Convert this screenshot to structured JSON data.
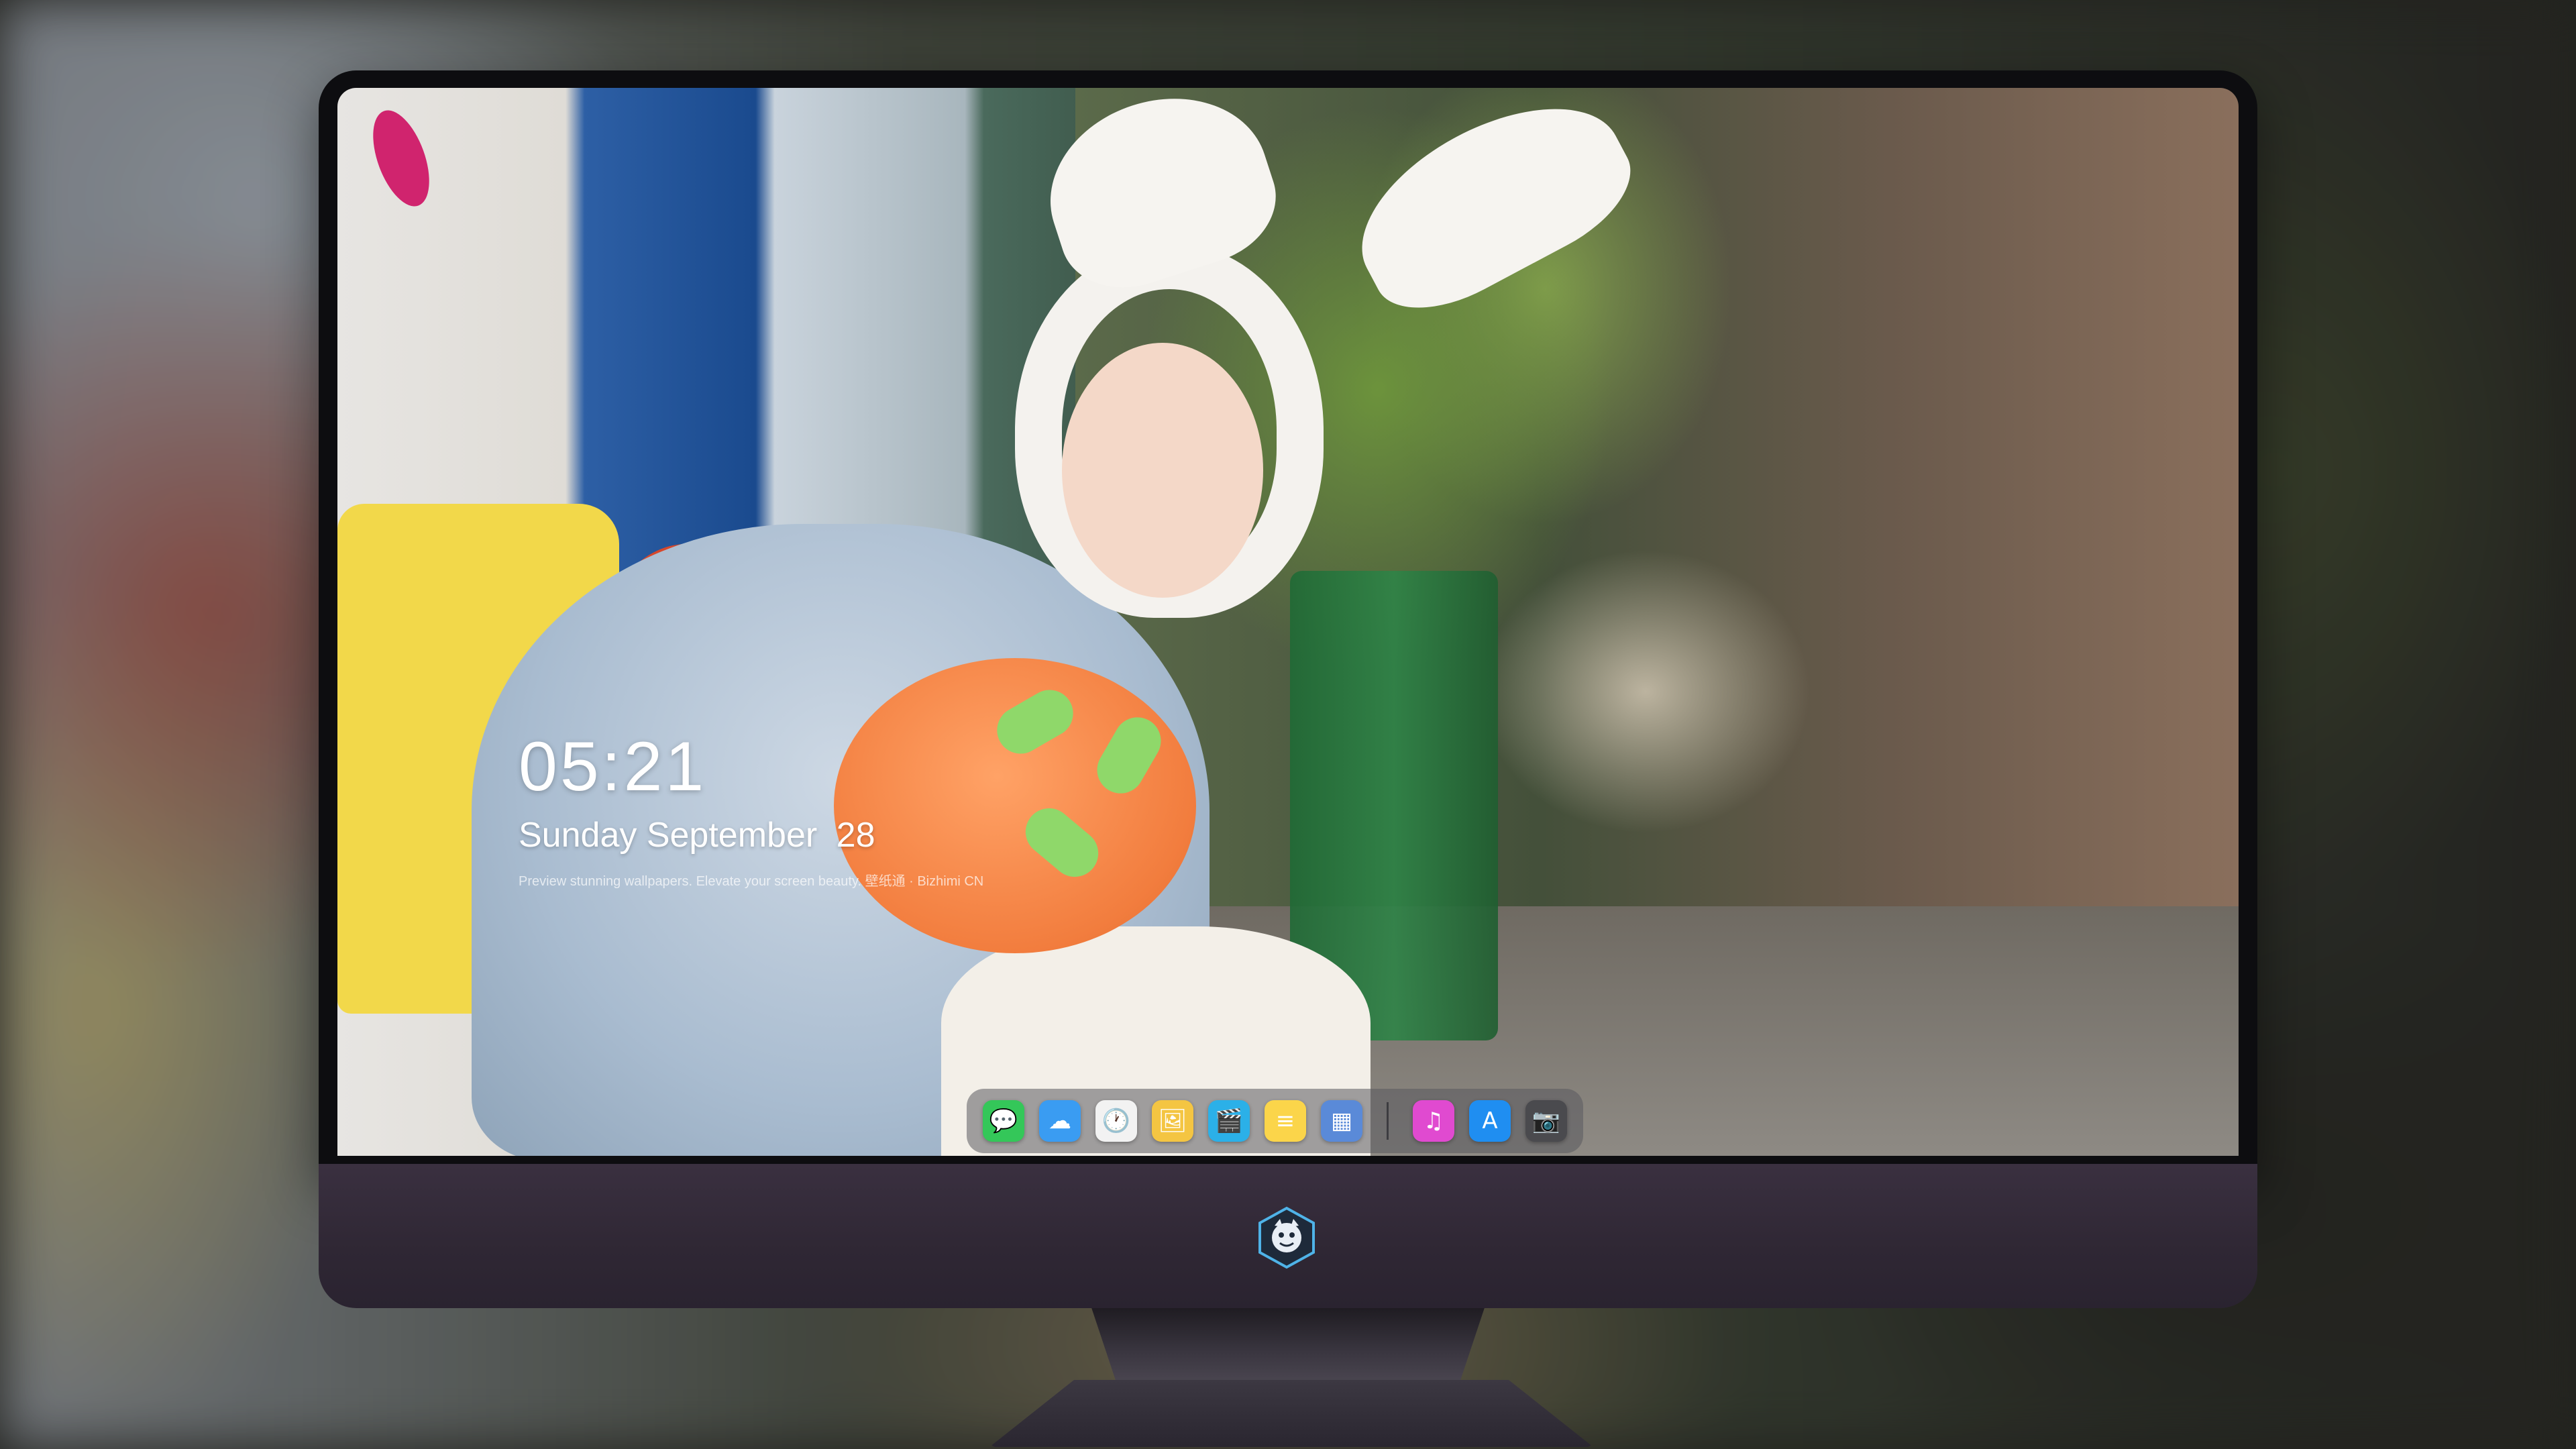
{
  "lock_screen": {
    "time": "05:21",
    "weekday": "Sunday",
    "month": "September",
    "day": "28",
    "tagline": "Preview stunning wallpapers. Elevate your screen beauty. 壁纸通 · Bizhimi CN"
  },
  "dock": {
    "apps": [
      {
        "name": "messages-icon",
        "glyph": "💬",
        "color": "#34c759"
      },
      {
        "name": "weather-icon",
        "glyph": "☁",
        "color": "#3a9cf2"
      },
      {
        "name": "clock-icon",
        "glyph": "🕐",
        "color": "#f2f2f2"
      },
      {
        "name": "preview-icon",
        "glyph": "🖼",
        "color": "#f4c542"
      },
      {
        "name": "video-editor-icon",
        "glyph": "🎬",
        "color": "#2bb0e8"
      },
      {
        "name": "notes-icon",
        "glyph": "≡",
        "color": "#fbd54a"
      },
      {
        "name": "photo-booth-icon",
        "glyph": "▦",
        "color": "#5a8ad8"
      }
    ],
    "apps_right": [
      {
        "name": "itunes-icon",
        "glyph": "♫",
        "color": "#e04ad0"
      },
      {
        "name": "app-store-icon",
        "glyph": "A",
        "color": "#1f8ef1"
      },
      {
        "name": "camera-icon",
        "glyph": "📷",
        "color": "#4a4a4e"
      }
    ]
  },
  "colors": {
    "chin": "#2f2734",
    "bezel": "#0d0d10",
    "dock_bg": "#5a5a5f",
    "text": "#ffffff"
  }
}
